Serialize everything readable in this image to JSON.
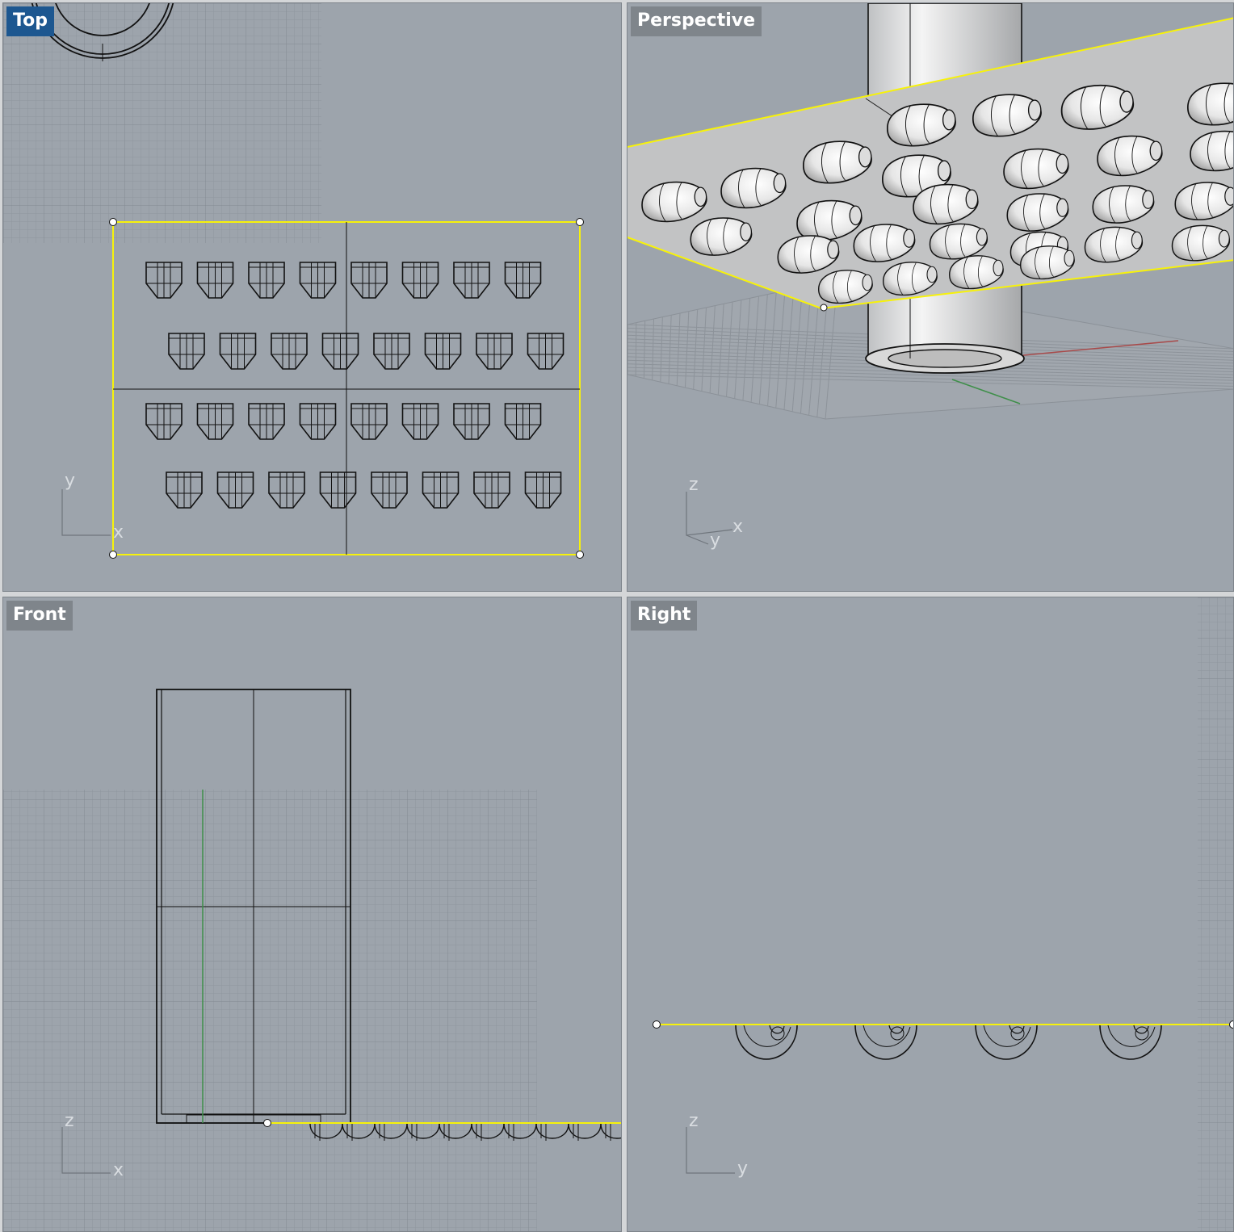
{
  "viewports": {
    "top": {
      "label": "Top",
      "active": true,
      "axes": {
        "v": "y",
        "h": "x"
      }
    },
    "persp": {
      "label": "Perspective",
      "active": false,
      "axes": {
        "v": "z",
        "h": "x",
        "d": "y"
      }
    },
    "front": {
      "label": "Front",
      "active": false,
      "axes": {
        "v": "z",
        "h": "x"
      }
    },
    "right": {
      "label": "Right",
      "active": false,
      "axes": {
        "v": "z",
        "h": "y"
      }
    }
  },
  "colors": {
    "viewport_bg": "#9da4ac",
    "grid_minor": "#8f969e",
    "grid_major": "#838a92",
    "selection": "#f7f20a",
    "active_label": "#1d5790",
    "inactive_label": "#7f858b",
    "x_axis": "#a84a4a",
    "y_axis": "#3f8f4a"
  }
}
